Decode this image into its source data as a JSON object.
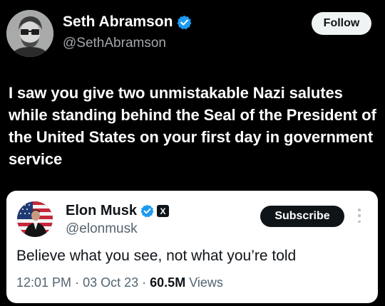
{
  "tweet": {
    "author": {
      "display_name": "Seth Abramson",
      "handle": "@SethAbramson",
      "avatar_icon": "person-with-glasses-avatar",
      "verified": true
    },
    "follow_label": "Follow",
    "text": "I saw you give two unmistakable Nazi salutes while standing behind the Seal of the President of the United States on your first day in government service"
  },
  "quoted_tweet": {
    "author": {
      "display_name": "Elon Musk",
      "handle": "@elonmusk",
      "avatar_icon": "person-with-flag-avatar",
      "verified": true,
      "affiliate_badge": "X"
    },
    "subscribe_label": "Subscribe",
    "text": "Believe what you see, not what you’re told",
    "time": "12:01 PM",
    "date": "03 Oct 23",
    "separator": "·",
    "views_count": "60.5M",
    "views_label": "Views"
  },
  "colors": {
    "background": "#000000",
    "verified_blue": "#1d9bf0",
    "card_background": "#ffffff",
    "secondary_text_dark": "#a0a7ad",
    "secondary_text_light": "#536471"
  }
}
